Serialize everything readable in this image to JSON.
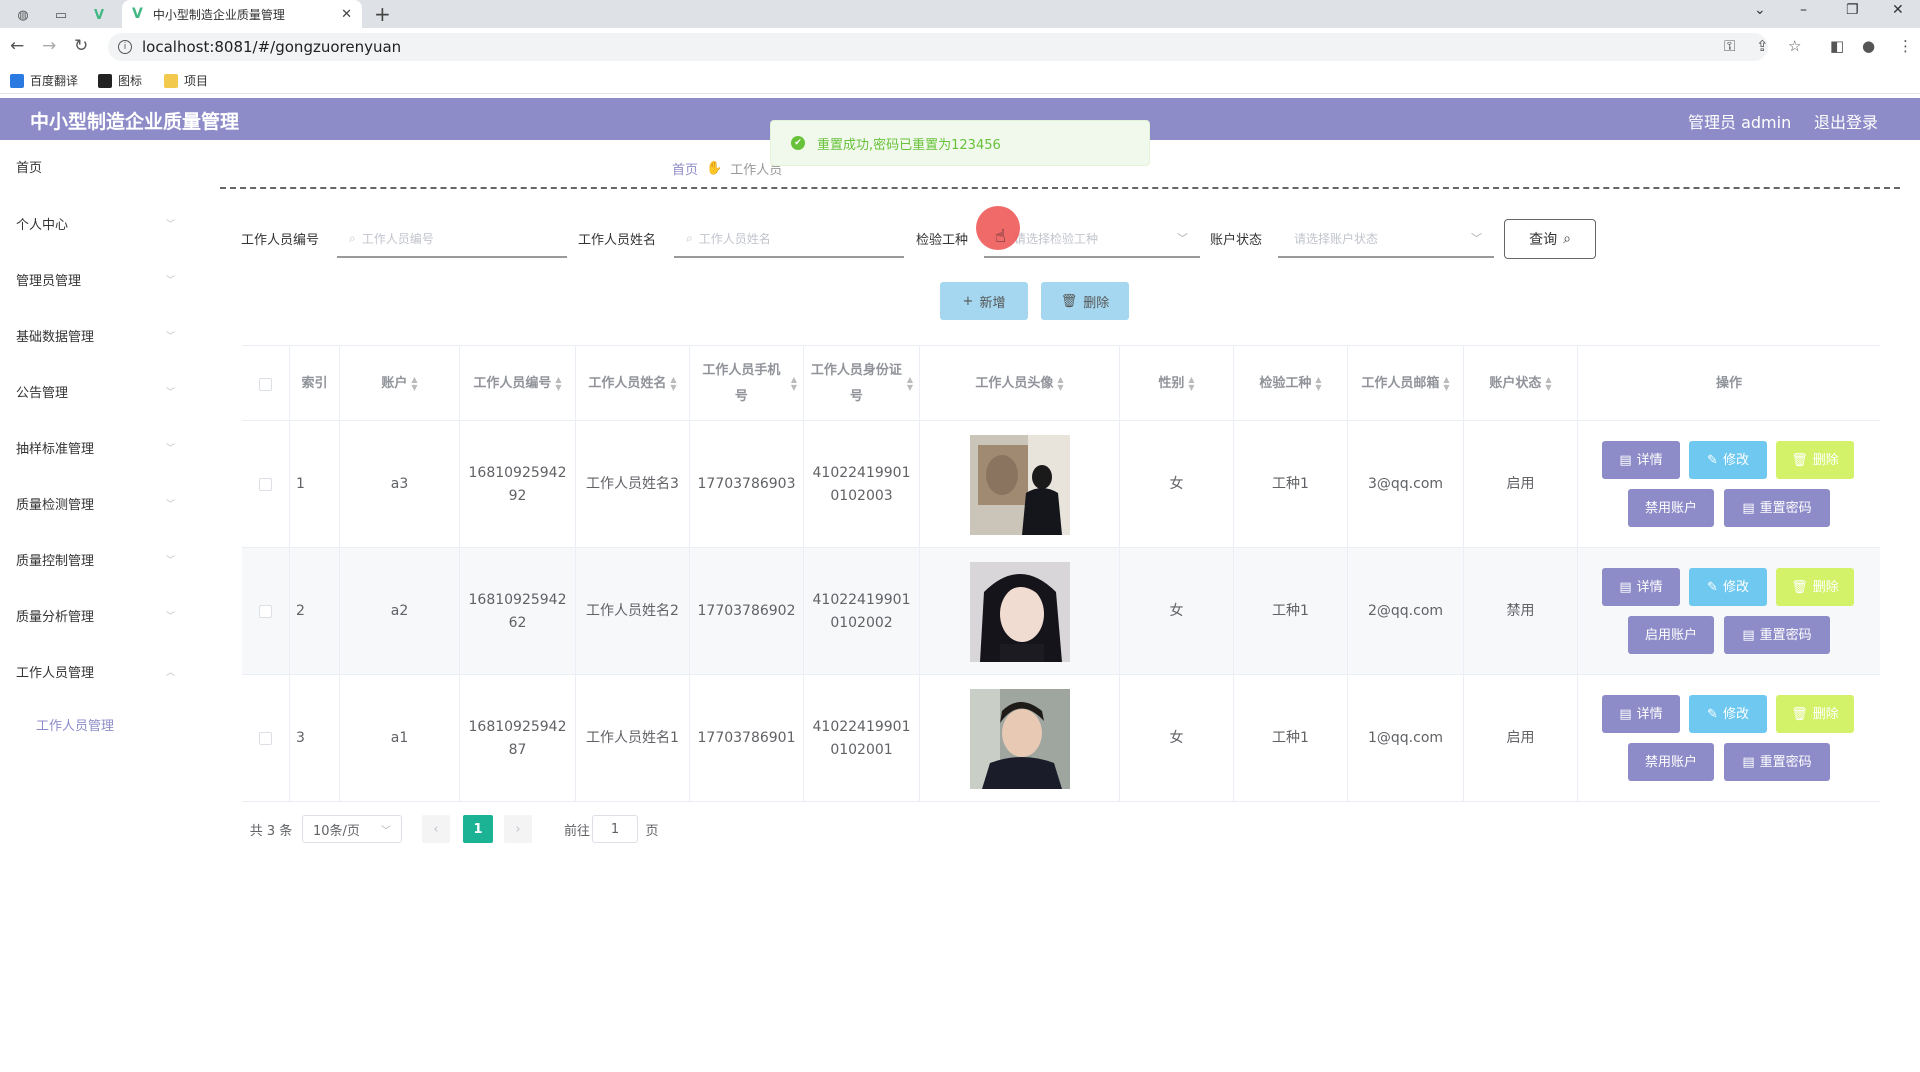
{
  "browser": {
    "tab_title": "中小型制造企业质量管理",
    "url": "localhost:8081/#/gongzuorenyuan",
    "bookmarks": [
      "百度翻译",
      "图标",
      "项目"
    ]
  },
  "header": {
    "title": "中小型制造企业质量管理",
    "admin": "管理员 admin",
    "logout": "退出登录"
  },
  "notification": "重置成功,密码已重置为123456",
  "breadcrumb": {
    "home": "首页",
    "current": "工作人员"
  },
  "sidebar": {
    "items": [
      "首页",
      "个人中心",
      "管理员管理",
      "基础数据管理",
      "公告管理",
      "抽样标准管理",
      "质量检测管理",
      "质量控制管理",
      "质量分析管理",
      "工作人员管理"
    ],
    "sub_item": "工作人员管理"
  },
  "search": {
    "staff_no_label": "工作人员编号",
    "staff_no_placeholder": "工作人员编号",
    "staff_name_label": "工作人员姓名",
    "staff_name_placeholder": "工作人员姓名",
    "type_label": "检验工种",
    "type_placeholder": "请选择检验工种",
    "status_label": "账户状态",
    "status_placeholder": "请选择账户状态",
    "query": "查询"
  },
  "actions": {
    "add": "新增",
    "delete": "删除"
  },
  "table": {
    "headers": [
      "索引",
      "账户",
      "工作人员编号",
      "工作人员姓名",
      "工作人员手机号",
      "工作人员身份证号",
      "工作人员头像",
      "性别",
      "检验工种",
      "工作人员邮箱",
      "账户状态",
      "操作"
    ],
    "rows": [
      {
        "index": "1",
        "account": "a3",
        "no": "1681092594292",
        "name": "工作人员姓名3",
        "phone": "17703786903",
        "id": "410224199010102003",
        "gender": "女",
        "type": "工种1",
        "email": "3@qq.com",
        "status": "启用",
        "toggle": "禁用账户"
      },
      {
        "index": "2",
        "account": "a2",
        "no": "1681092594262",
        "name": "工作人员姓名2",
        "phone": "17703786902",
        "id": "410224199010102002",
        "gender": "女",
        "type": "工种1",
        "email": "2@qq.com",
        "status": "禁用",
        "toggle": "启用账户"
      },
      {
        "index": "3",
        "account": "a1",
        "no": "1681092594287",
        "name": "工作人员姓名1",
        "phone": "17703786901",
        "id": "410224199010102001",
        "gender": "女",
        "type": "工种1",
        "email": "1@qq.com",
        "status": "启用",
        "toggle": "禁用账户"
      }
    ],
    "ops": {
      "detail": "详情",
      "edit": "修改",
      "delete": "删除",
      "reset": "重置密码"
    }
  },
  "pagination": {
    "total": "共 3 条",
    "page_size": "10条/页",
    "current": "1",
    "goto_prefix": "前往",
    "goto_value": "1",
    "goto_suffix": "页"
  },
  "colors": {
    "primary": "#8e8cc8",
    "edit": "#6ec8ef",
    "delete": "#d3f26a",
    "success": "#67c23a",
    "page_active": "#1bb394"
  }
}
